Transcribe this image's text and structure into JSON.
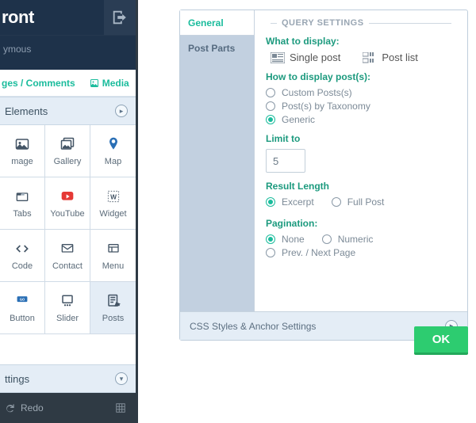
{
  "sidebar": {
    "logo": "ront",
    "user": "ymous",
    "tab_a": "ges / Comments",
    "tab_b": "Media",
    "section_elements": "Elements",
    "section_settings": "ttings",
    "redo": "Redo",
    "items": [
      {
        "label": "mage"
      },
      {
        "label": "Gallery"
      },
      {
        "label": "Map"
      },
      {
        "label": "Tabs"
      },
      {
        "label": "YouTube"
      },
      {
        "label": "Widget"
      },
      {
        "label": "Code"
      },
      {
        "label": "Contact"
      },
      {
        "label": "Menu"
      },
      {
        "label": "Button"
      },
      {
        "label": "Slider"
      },
      {
        "label": "Posts"
      }
    ]
  },
  "panel": {
    "tabs": {
      "general": "General",
      "post_parts": "Post Parts"
    },
    "legend": "QUERY SETTINGS",
    "what_to_display": "What to display:",
    "single_post": "Single post",
    "post_list": "Post list",
    "how_to_display": "How to display post(s):",
    "custom_posts": "Custom Posts(s)",
    "by_taxonomy": "Post(s) by Taxonomy",
    "generic": "Generic",
    "limit_to": "Limit to",
    "limit_value": "5",
    "result_length": "Result Length",
    "excerpt": "Excerpt",
    "full_post": "Full Post",
    "pagination": "Pagination:",
    "pag_none": "None",
    "pag_numeric": "Numeric",
    "pag_prevnext": "Prev. / Next Page",
    "css_row": "CSS Styles & Anchor Settings"
  },
  "ok": "OK"
}
